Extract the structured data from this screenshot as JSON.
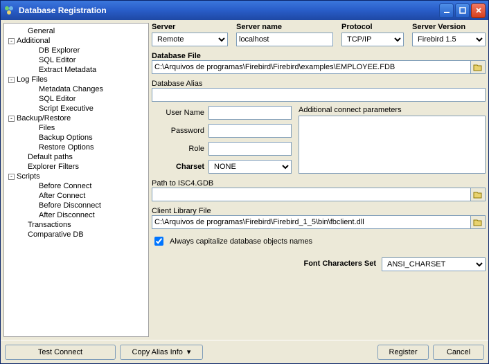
{
  "window": {
    "title": "Database Registration"
  },
  "tree": {
    "items": [
      {
        "label": "General",
        "expand": "",
        "indent": 16
      },
      {
        "label": "Additional",
        "expand": "-",
        "indent": 0
      },
      {
        "label": "DB Explorer",
        "expand": "",
        "indent": 32
      },
      {
        "label": "SQL Editor",
        "expand": "",
        "indent": 32
      },
      {
        "label": "Extract Metadata",
        "expand": "",
        "indent": 32
      },
      {
        "label": "Log Files",
        "expand": "-",
        "indent": 0
      },
      {
        "label": "Metadata Changes",
        "expand": "",
        "indent": 32
      },
      {
        "label": "SQL Editor",
        "expand": "",
        "indent": 32
      },
      {
        "label": "Script Executive",
        "expand": "",
        "indent": 32
      },
      {
        "label": "Backup/Restore",
        "expand": "-",
        "indent": 0
      },
      {
        "label": "Files",
        "expand": "",
        "indent": 32
      },
      {
        "label": "Backup Options",
        "expand": "",
        "indent": 32
      },
      {
        "label": "Restore Options",
        "expand": "",
        "indent": 32
      },
      {
        "label": "Default paths",
        "expand": "",
        "indent": 16
      },
      {
        "label": "Explorer Filters",
        "expand": "",
        "indent": 16
      },
      {
        "label": "Scripts",
        "expand": "-",
        "indent": 0
      },
      {
        "label": "Before Connect",
        "expand": "",
        "indent": 32
      },
      {
        "label": "After Connect",
        "expand": "",
        "indent": 32
      },
      {
        "label": "Before Disconnect",
        "expand": "",
        "indent": 32
      },
      {
        "label": "After Disconnect",
        "expand": "",
        "indent": 32
      },
      {
        "label": "Transactions",
        "expand": "",
        "indent": 16
      },
      {
        "label": "Comparative DB",
        "expand": "",
        "indent": 16
      }
    ]
  },
  "form": {
    "server_label": "Server",
    "server_value": "Remote",
    "servername_label": "Server name",
    "servername_value": "localhost",
    "protocol_label": "Protocol",
    "protocol_value": "TCP/IP",
    "version_label": "Server Version",
    "version_value": "Firebird 1.5",
    "dbfile_label": "Database File",
    "dbfile_value": "C:\\Arquivos de programas\\Firebird\\Firebird\\examples\\EMPLOYEE.FDB",
    "alias_label": "Database Alias",
    "alias_value": "",
    "username_label": "User Name",
    "username_value": "",
    "password_label": "Password",
    "password_value": "",
    "role_label": "Role",
    "role_value": "",
    "charset_label": "Charset",
    "charset_value": "NONE",
    "extra_label": "Additional connect parameters",
    "isc4_label": "Path to ISC4.GDB",
    "isc4_value": "",
    "clientlib_label": "Client Library File",
    "clientlib_value": "C:\\Arquivos de programas\\Firebird\\Firebird_1_5\\bin\\fbclient.dll",
    "capitalize_label": "Always capitalize database objects names",
    "fontcharset_label": "Font Characters Set",
    "fontcharset_value": "ANSI_CHARSET"
  },
  "footer": {
    "test": "Test Connect",
    "copyalias": "Copy Alias Info",
    "register": "Register",
    "cancel": "Cancel"
  }
}
